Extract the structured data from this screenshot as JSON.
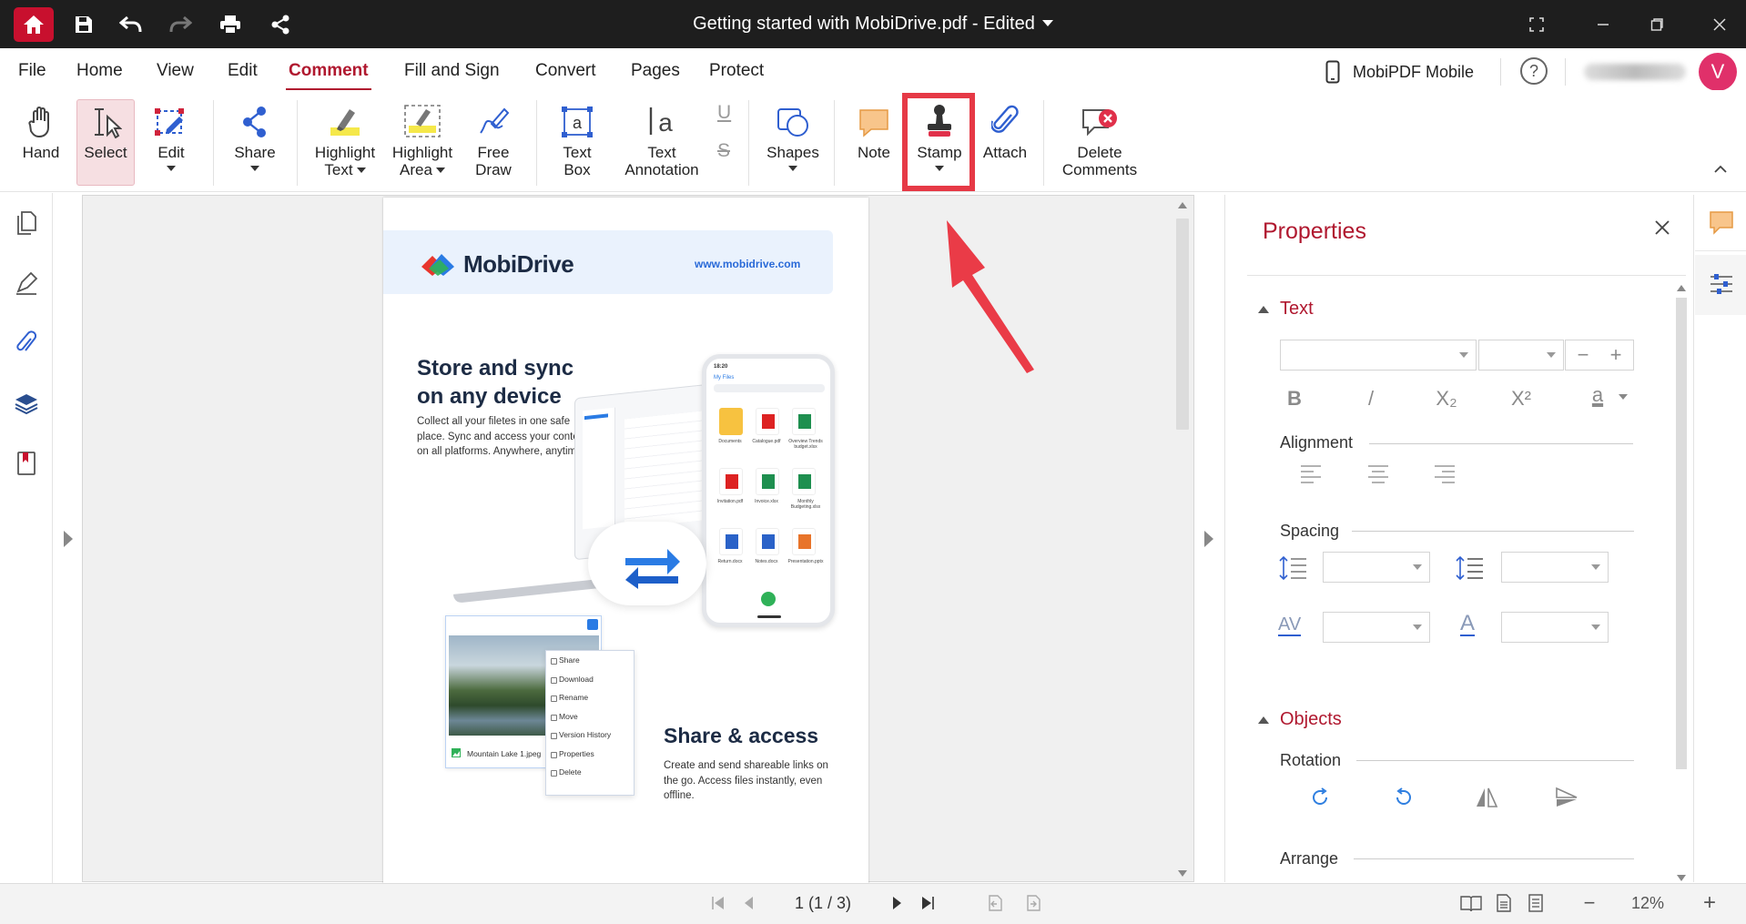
{
  "titlebar": {
    "document_title": "Getting started with MobiDrive.pdf - Edited"
  },
  "menu": {
    "items": [
      "File",
      "Home",
      "View",
      "Edit",
      "Comment",
      "Fill and Sign",
      "Convert",
      "Pages",
      "Protect"
    ],
    "active": "Comment",
    "mobile_label": "MobiPDF Mobile",
    "help_label": "?",
    "avatar_initial": "V"
  },
  "ribbon": {
    "hand": "Hand",
    "select": "Select",
    "edit": "Edit",
    "share": "Share",
    "highlight_text_1": "Highlight",
    "highlight_text_2": "Text",
    "highlight_area_1": "Highlight",
    "highlight_area_2": "Area",
    "free_draw_1": "Free",
    "free_draw_2": "Draw",
    "text_box_1": "Text",
    "text_box_2": "Box",
    "text_annotation_1": "Text",
    "text_annotation_2": "Annotation",
    "underline_glyph": "U",
    "strike_glyph": "S",
    "shapes": "Shapes",
    "note": "Note",
    "stamp": "Stamp",
    "attach": "Attach",
    "delete_comments_1": "Delete",
    "delete_comments_2": "Comments"
  },
  "document": {
    "brand": "MobiDrive",
    "url": "www.mobidrive.com",
    "heading1_line1": "Store and sync",
    "heading1_line2": "on any device",
    "para1": "Collect all your filetes in one safe place. Sync and access your content on all platforms. Anywhere, anytime.",
    "heading2": "Share & access",
    "para2": "Create and send shareable links on the go. Access files instantly, even offline.",
    "photo_caption": "Mountain Lake 1.jpeg",
    "context_menu": [
      "Share",
      "Download",
      "Rename",
      "Move",
      "Version History",
      "Properties",
      "Delete"
    ],
    "phone_header": "My Files",
    "phone_time": "18:20",
    "phone_files": [
      "Documents",
      "Catalogue.pdf",
      "Overview Trends budget.xlsx",
      "Invitation.pdf",
      "Invoice.xlsx",
      "Monthly Budgeting.xlsx",
      "Return.docx",
      "Notes.docx",
      "Presentation.pptx"
    ]
  },
  "properties": {
    "title": "Properties",
    "text_section": "Text",
    "bold": "B",
    "italic": "/",
    "subscript": "X₂",
    "superscript": "X²",
    "font_color_glyph": "a",
    "alignment": "Alignment",
    "spacing": "Spacing",
    "spacing_char_glyph": "AV",
    "spacing_a_glyph": "A",
    "objects_section": "Objects",
    "rotation": "Rotation",
    "arrange": "Arrange",
    "size_minus": "−",
    "size_plus": "+"
  },
  "status": {
    "page_indicator": "1 (1 / 3)",
    "zoom": "12%",
    "zoom_minus": "−",
    "zoom_plus": "+"
  },
  "colors": {
    "accent": "#b0182f",
    "titlebar": "#1e1e1e",
    "stamp_highlight": "#e63946"
  }
}
